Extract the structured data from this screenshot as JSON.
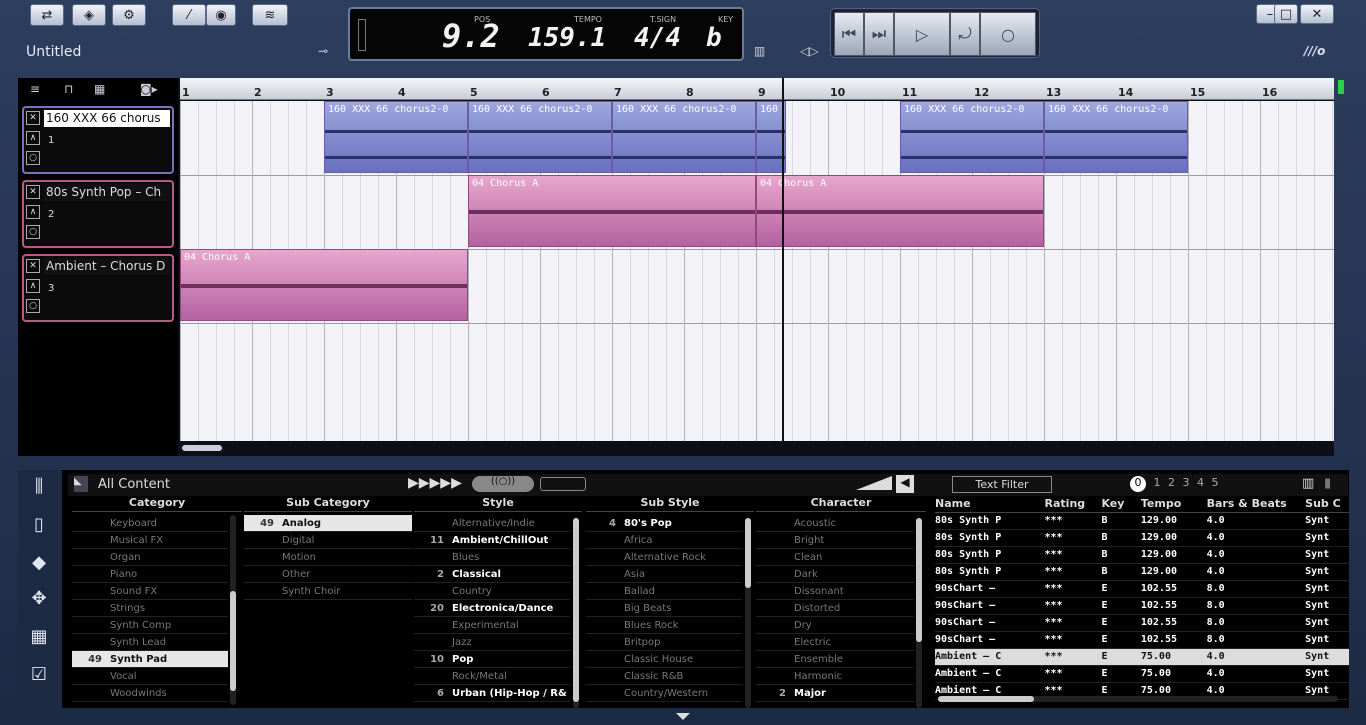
{
  "window": {
    "title": "Untitled",
    "controls": {
      "minimize": "–",
      "maximize": "□",
      "close": "✕"
    }
  },
  "lcd": {
    "pos_label": "POS",
    "pos": "9.2",
    "tempo_label": "TEMPO",
    "tempo": "159.1",
    "tsig_label": "T.SIGN",
    "tsig": "4/4",
    "key_label": "KEY",
    "key": "b"
  },
  "transport": {
    "rewind": "⏮",
    "forward": "⏭",
    "play": "▷",
    "loop": "⤾",
    "record": "○"
  },
  "ruler": [
    "1",
    "2",
    "3",
    "4",
    "5",
    "6",
    "7",
    "8",
    "9",
    "10",
    "11",
    "12",
    "13",
    "14",
    "15",
    "16"
  ],
  "tracks": [
    {
      "name": "160 XXX 66 chorus",
      "num": "1"
    },
    {
      "name": "80s Synth Pop – Ch",
      "num": "2"
    },
    {
      "name": "Ambient – Chorus D",
      "num": "3"
    }
  ],
  "clips": {
    "audio": "160 XXX 66 chorus2-0",
    "audio_short": "160",
    "midi": "04 Chorus A"
  },
  "browser": {
    "all_content": "All Content",
    "text_filter": "Text Filter",
    "ratings": [
      "0",
      "1",
      "2",
      "3",
      "4",
      "5"
    ],
    "headers": {
      "category": "Category",
      "subcategory": "Sub Category",
      "style": "Style",
      "substyle": "Sub Style",
      "character": "Character"
    },
    "category": [
      {
        "label": "Keyboard"
      },
      {
        "label": "Musical FX"
      },
      {
        "label": "Organ"
      },
      {
        "label": "Piano"
      },
      {
        "label": "Sound FX"
      },
      {
        "label": "Strings"
      },
      {
        "label": "Synth Comp"
      },
      {
        "label": "Synth Lead"
      },
      {
        "label": "Synth Pad",
        "count": "49",
        "sel": true
      },
      {
        "label": "Vocal"
      },
      {
        "label": "Woodwinds"
      }
    ],
    "subcategory": [
      {
        "label": "Analog",
        "count": "49",
        "sel": true
      },
      {
        "label": "Digital"
      },
      {
        "label": "Motion"
      },
      {
        "label": "Other"
      },
      {
        "label": "Synth Choir"
      }
    ],
    "style": [
      {
        "label": "Alternative/Indie"
      },
      {
        "label": "Ambient/ChillOut",
        "count": "11",
        "bold": true
      },
      {
        "label": "Blues"
      },
      {
        "label": "Classical",
        "count": "2",
        "bold": true
      },
      {
        "label": "Country"
      },
      {
        "label": "Electronica/Dance",
        "count": "20",
        "bold": true
      },
      {
        "label": "Experimental"
      },
      {
        "label": "Jazz"
      },
      {
        "label": "Pop",
        "count": "10",
        "bold": true
      },
      {
        "label": "Rock/Metal"
      },
      {
        "label": "Urban (Hip-Hop / R&",
        "count": "6",
        "bold": true
      }
    ],
    "substyle": [
      {
        "label": "80's Pop",
        "count": "4",
        "bold": true
      },
      {
        "label": "Africa"
      },
      {
        "label": "Alternative Rock"
      },
      {
        "label": "Asia"
      },
      {
        "label": "Ballad"
      },
      {
        "label": "Big Beats"
      },
      {
        "label": "Blues Rock"
      },
      {
        "label": "Britpop"
      },
      {
        "label": "Classic House"
      },
      {
        "label": "Classic R&B"
      },
      {
        "label": "Country/Western"
      }
    ],
    "character": [
      {
        "label": "Acoustic"
      },
      {
        "label": "Bright"
      },
      {
        "label": "Clean"
      },
      {
        "label": "Dark"
      },
      {
        "label": "Dissonant"
      },
      {
        "label": "Distorted"
      },
      {
        "label": "Dry"
      },
      {
        "label": "Electric"
      },
      {
        "label": "Ensemble"
      },
      {
        "label": "Harmonic"
      },
      {
        "label": "Major",
        "count": "2",
        "bold": true
      }
    ],
    "results": {
      "headers": [
        "Name",
        "Rating",
        "Key",
        "Tempo",
        "Bars & Beats",
        "Sub C"
      ],
      "rows": [
        {
          "name": "80s Synth P",
          "rating": "***",
          "key": "B",
          "tempo": "129.00",
          "bars": "4.0",
          "sub": "Synt"
        },
        {
          "name": "80s Synth P",
          "rating": "***",
          "key": "B",
          "tempo": "129.00",
          "bars": "4.0",
          "sub": "Synt"
        },
        {
          "name": "80s Synth P",
          "rating": "***",
          "key": "B",
          "tempo": "129.00",
          "bars": "4.0",
          "sub": "Synt"
        },
        {
          "name": "80s Synth P",
          "rating": "***",
          "key": "B",
          "tempo": "129.00",
          "bars": "4.0",
          "sub": "Synt"
        },
        {
          "name": "90sChart –",
          "rating": "***",
          "key": "E",
          "tempo": "102.55",
          "bars": "8.0",
          "sub": "Synt"
        },
        {
          "name": "90sChart –",
          "rating": "***",
          "key": "E",
          "tempo": "102.55",
          "bars": "8.0",
          "sub": "Synt"
        },
        {
          "name": "90sChart –",
          "rating": "***",
          "key": "E",
          "tempo": "102.55",
          "bars": "8.0",
          "sub": "Synt"
        },
        {
          "name": "90sChart –",
          "rating": "***",
          "key": "E",
          "tempo": "102.55",
          "bars": "8.0",
          "sub": "Synt"
        },
        {
          "name": "Ambient – C",
          "rating": "***",
          "key": "E",
          "tempo": "75.00",
          "bars": "4.0",
          "sub": "Synt",
          "sel": true
        },
        {
          "name": "Ambient – C",
          "rating": "***",
          "key": "E",
          "tempo": "75.00",
          "bars": "4.0",
          "sub": "Synt"
        },
        {
          "name": "Ambient – C",
          "rating": "***",
          "key": "E",
          "tempo": "75.00",
          "bars": "4.0",
          "sub": "Synt"
        }
      ]
    }
  }
}
